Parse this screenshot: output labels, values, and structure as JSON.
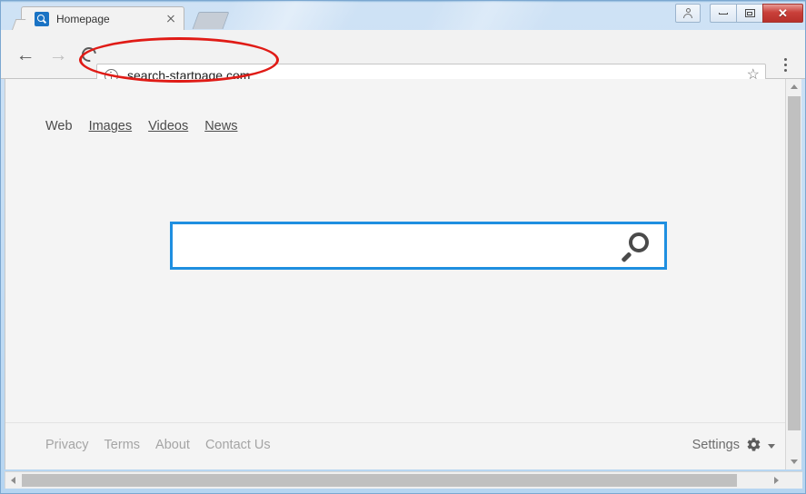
{
  "window": {
    "controls": {
      "profile_icon": "person-icon",
      "minimize_label": "",
      "maximize_label": "",
      "close_label": "✕"
    }
  },
  "tabs": [
    {
      "title": "Homepage",
      "favicon": "search-magnifier-favicon",
      "close_label": ""
    }
  ],
  "new_tab": {
    "label": ""
  },
  "toolbar": {
    "back_glyph": "←",
    "forward_glyph": "→",
    "reload_name": "reload-icon",
    "security_icon": "info-circle-icon",
    "url": "search-startpage.com",
    "bookmark_glyph": "☆",
    "menu_name": "three-dot-menu-icon"
  },
  "page": {
    "nav_links": [
      {
        "label": "Web",
        "underlined": false
      },
      {
        "label": "Images",
        "underlined": true
      },
      {
        "label": "Videos",
        "underlined": true
      },
      {
        "label": "News",
        "underlined": true
      }
    ],
    "search": {
      "value": "",
      "placeholder": "",
      "submit_icon": "magnifier-icon"
    },
    "footer_links": [
      "Privacy",
      "Terms",
      "About",
      "Contact Us"
    ],
    "settings": {
      "label": "Settings",
      "gear_icon": "gear-icon",
      "caret_icon": "chevron-down-icon"
    }
  },
  "annotation": {
    "shape": "ellipse",
    "color": "#e01b16",
    "target": "address-bar-url"
  },
  "colors": {
    "accent_blue": "#1f8fe0",
    "titlebar_blue": "#c2dcf4",
    "page_bg": "#f4f4f4",
    "toolbar_bg": "#f2f2f2",
    "annotation_red": "#e01b16",
    "favicon_blue": "#1a73c4"
  }
}
